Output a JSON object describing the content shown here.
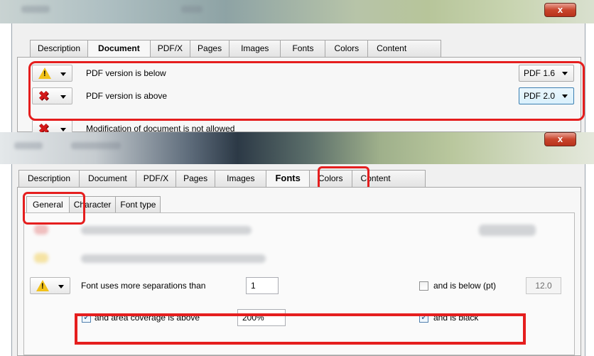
{
  "window_top": {
    "close_label": "x",
    "tabs": [
      "Description",
      "Document",
      "PDF/X",
      "Pages",
      "Images",
      "Fonts",
      "Colors",
      "Content"
    ],
    "active_tab": "Document",
    "rows": [
      {
        "icon": "warning-icon",
        "label": "PDF version is below",
        "select": "PDF 1.6"
      },
      {
        "icon": "error-icon",
        "label": "PDF version is above",
        "select": "PDF 2.0"
      },
      {
        "icon": "error-icon",
        "label": "Modification of document is not allowed"
      }
    ]
  },
  "window_bottom": {
    "close_label": "x",
    "tabs": [
      "Description",
      "Document",
      "PDF/X",
      "Pages",
      "Images",
      "Fonts",
      "Colors",
      "Content"
    ],
    "active_tab": "Fonts",
    "subtabs": [
      "General",
      "Character",
      "Font type"
    ],
    "active_subtab": "General",
    "separation_row": {
      "icon": "warning-icon",
      "label": "Font uses more separations than",
      "value": "1",
      "below_label": "and is below (pt)",
      "below_checked": false,
      "below_value": "12.0"
    },
    "coverage_row": {
      "coverage_label": "and area coverage is above",
      "coverage_checked": true,
      "coverage_value": "200%",
      "black_label": "and is black",
      "black_checked": true
    }
  },
  "colors": {
    "highlight": "#e51e1e",
    "warning": "#f2c21b",
    "error": "#d31919"
  }
}
